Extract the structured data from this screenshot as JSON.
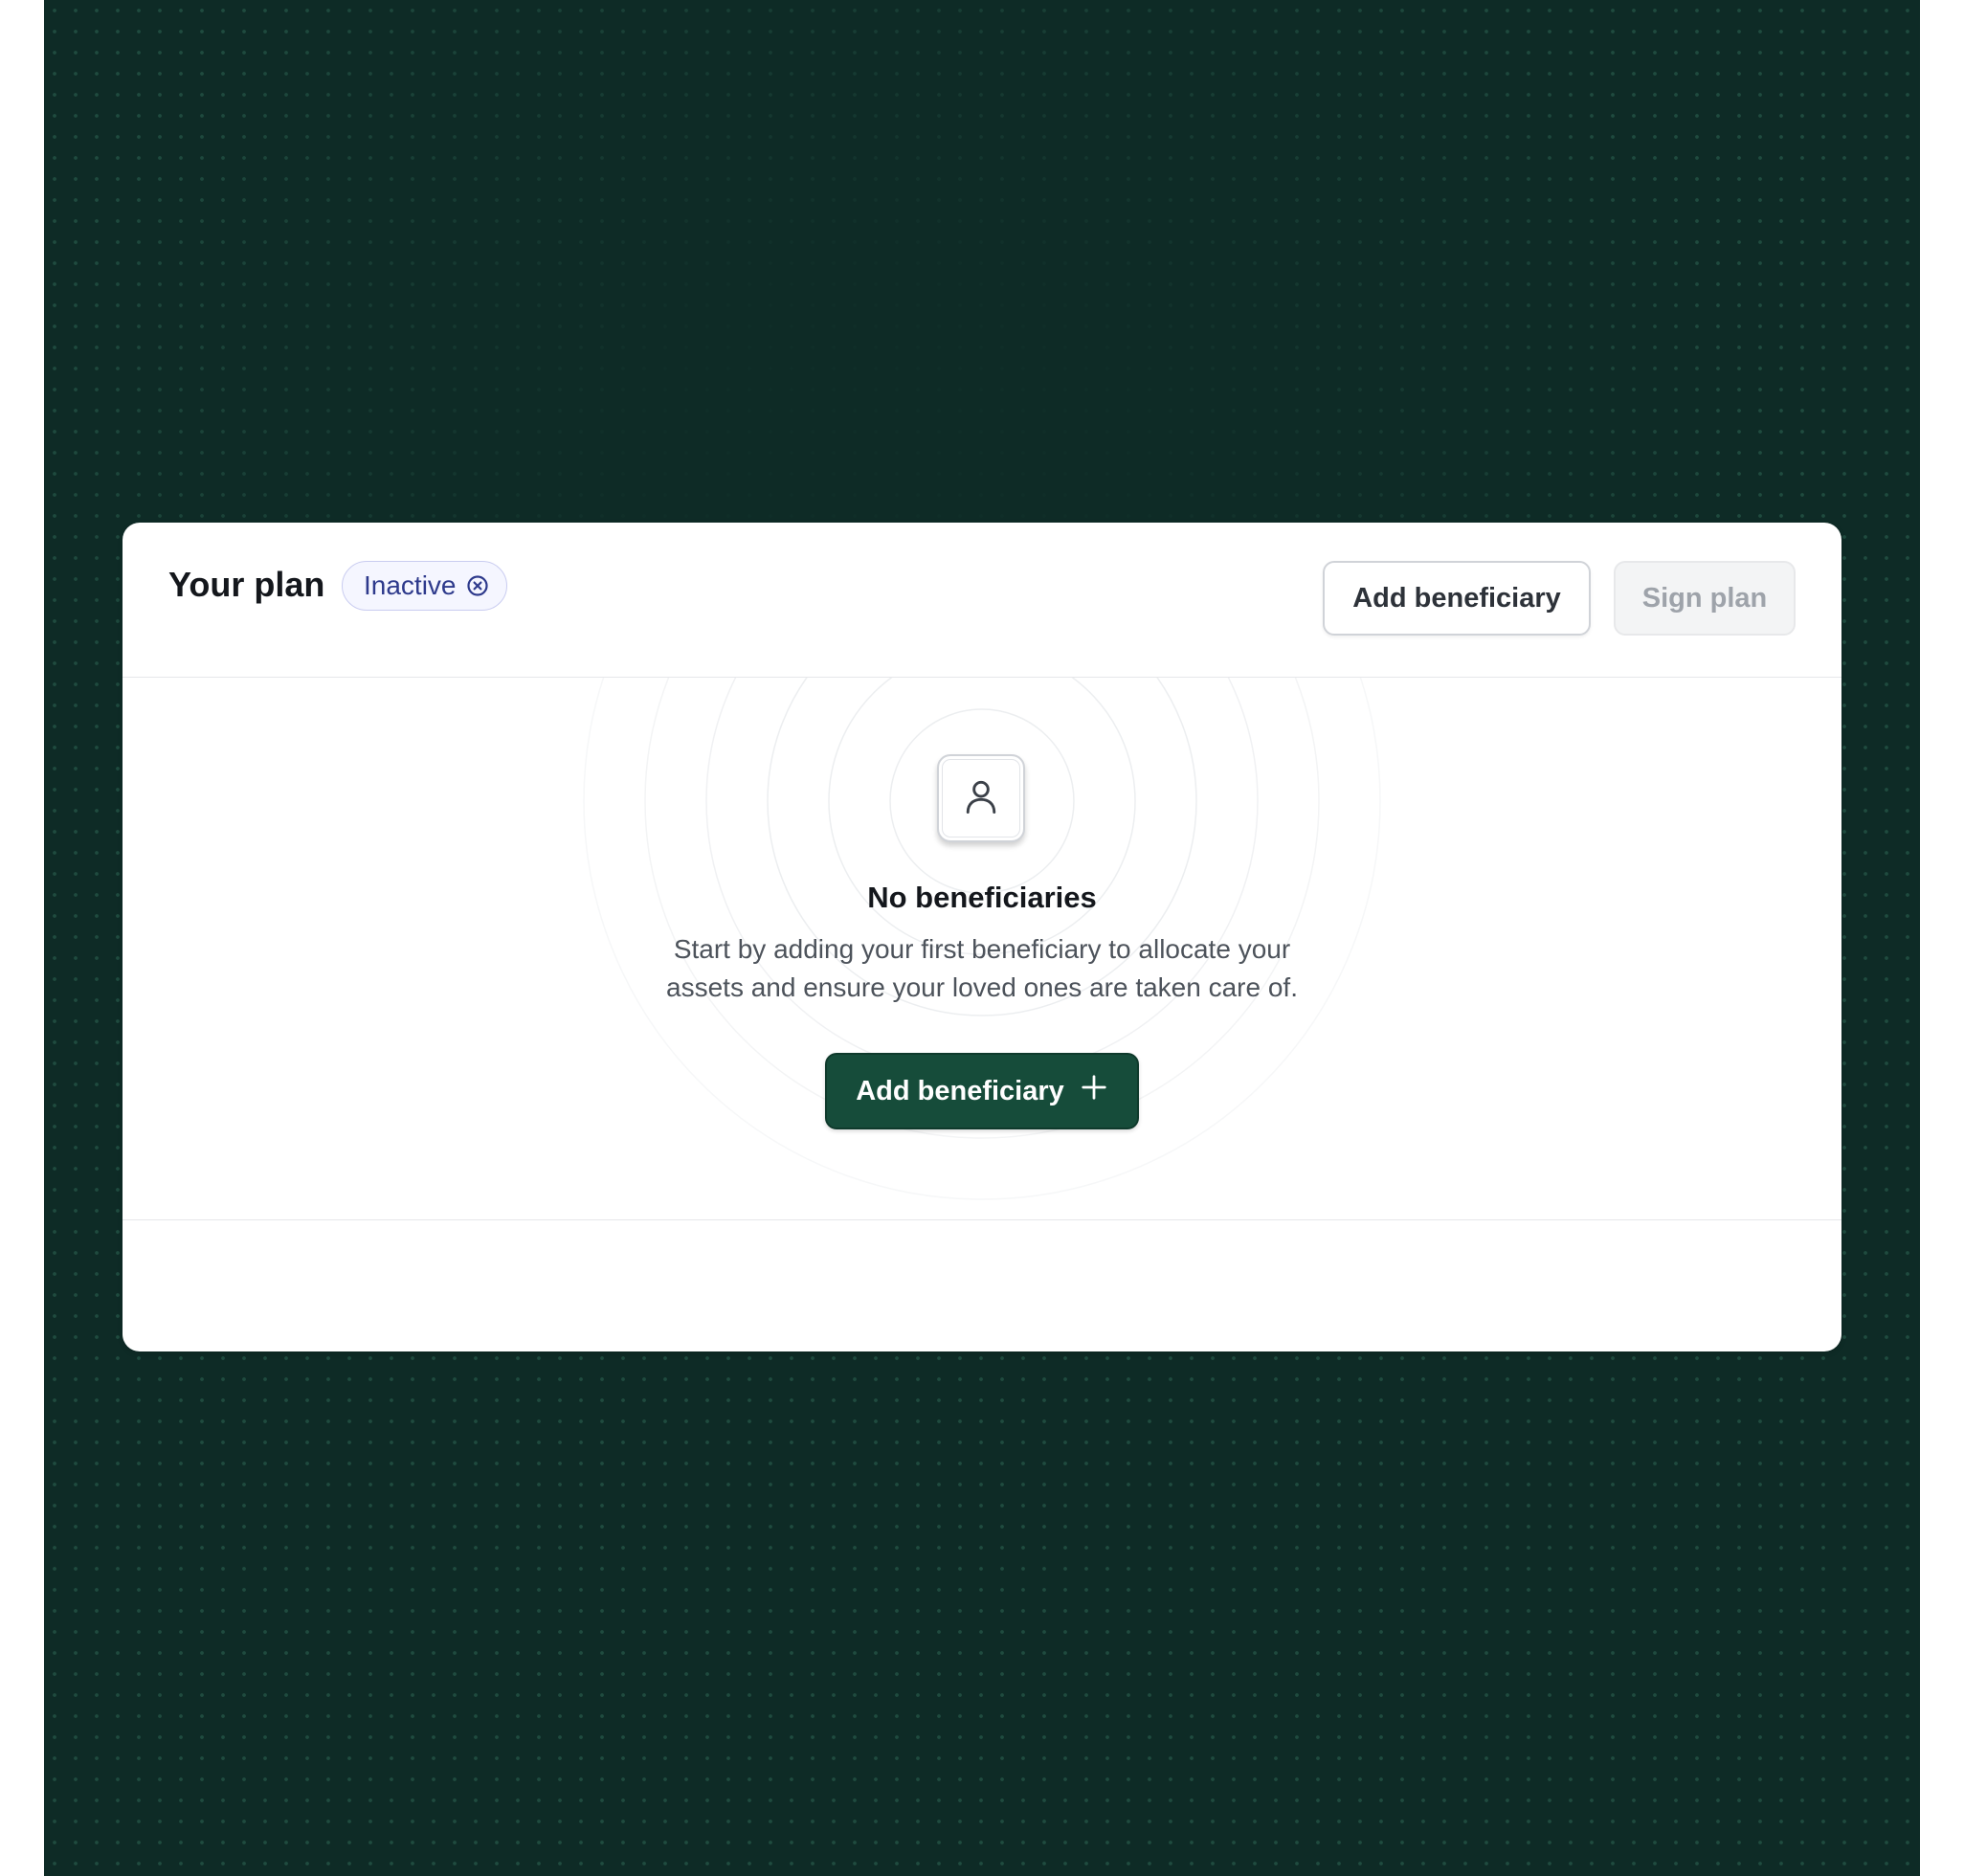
{
  "header": {
    "title": "Your plan",
    "status_badge": "Inactive",
    "add_beneficiary_label": "Add beneficiary",
    "sign_plan_label": "Sign plan"
  },
  "empty_state": {
    "icon": "user-icon",
    "title": "No beneficiaries",
    "description_line1": "Start by adding your first beneficiary to allocate your",
    "description_line2": "assets and ensure your loved ones are taken care of.",
    "cta_label": "Add beneficiary",
    "cta_icon": "plus-icon"
  },
  "colors": {
    "background": "#0e2b26",
    "primary_button": "#164c3a",
    "badge_text": "#2e3a8c"
  }
}
